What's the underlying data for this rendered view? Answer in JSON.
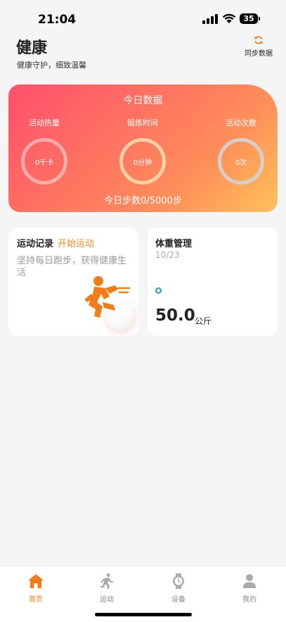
{
  "status_bar": {
    "time": "21:04",
    "battery": "35"
  },
  "header": {
    "title": "健康",
    "subtitle": "健康守护，细致温馨",
    "sync_label": "同步数据"
  },
  "today": {
    "title": "今日数据",
    "metrics": [
      {
        "label": "活动热量",
        "value": "0千卡"
      },
      {
        "label": "锻炼时间",
        "value": "0分钟"
      },
      {
        "label": "活动次数",
        "value": "0次"
      }
    ],
    "steps_text": "今日步数0/5000步"
  },
  "sport_card": {
    "title": "运动记录",
    "action": "开始运动",
    "description": "坚持每日跑步，获得健康生活"
  },
  "weight_card": {
    "title": "体重管理",
    "date": "10/23",
    "value": "50.0",
    "unit": "公斤"
  },
  "tabs": [
    {
      "label": "首页",
      "icon": "home-icon",
      "active": true
    },
    {
      "label": "运动",
      "icon": "running-icon",
      "active": false
    },
    {
      "label": "设备",
      "icon": "watch-icon",
      "active": false
    },
    {
      "label": "我的",
      "icon": "profile-icon",
      "active": false
    }
  ],
  "colors": {
    "accent": "#f07d1a",
    "card_gradient_start": "#ff4f6d",
    "card_gradient_end": "#ffc25a",
    "weight_dot": "#1d9bd7"
  }
}
